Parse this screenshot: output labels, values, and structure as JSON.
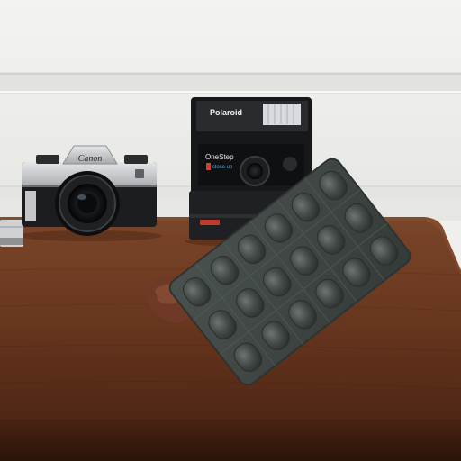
{
  "camera_left": {
    "brand": "Canon"
  },
  "camera_right": {
    "brand": "Polaroid",
    "model": "OneStep",
    "submodel": "close up"
  },
  "colors": {
    "wall": "#efefed",
    "table": "#6b3a22",
    "blister_pack": "#3e4542"
  }
}
